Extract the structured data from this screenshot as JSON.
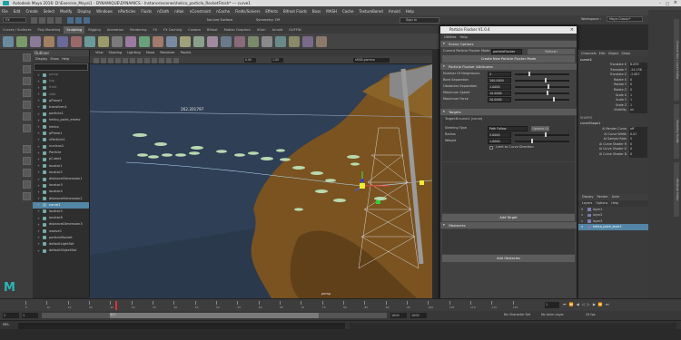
{
  "window": {
    "title": "Autodesk Maya 2016: D:\\Exercise_Maya\\1 - DYNAMIQUE\\DYNAMICS - Instance\\scenes\\helico_particle_RocketFinish*    ---   curve1",
    "workspace_label": "Workspace :",
    "workspace_value": "Maya Classic*"
  },
  "menubar": [
    "File",
    "Edit",
    "Create",
    "Select",
    "Modify",
    "Display",
    "Windows",
    "nParticles",
    "Fluids",
    "nCloth",
    "nHair",
    "nConstraint",
    "nCache",
    "Fields/Solvers",
    "Effects",
    "Bifrost Fluids",
    "Boss",
    "MASH",
    "Cache",
    "TextureBored",
    "Arnold",
    "Help"
  ],
  "statusline": {
    "mode": "FX",
    "live_surface": "No Live Surface",
    "symmetry": "Symmetry: Off",
    "sign_in": "Sign In"
  },
  "shelf_tabs": [
    "Curves / Surfaces",
    "Poly Modeling",
    "Sculpting",
    "Rigging",
    "Animation",
    "Rendering",
    "FX",
    "FX Caching",
    "Custom",
    "Bifrost",
    "Motion Graphics",
    "XGen",
    "Arnold",
    "GUFFIN"
  ],
  "shelf_active": "Sculpting",
  "outliner": {
    "title": "Outliner",
    "menu": [
      "Display",
      "Show",
      "Help"
    ],
    "items": [
      {
        "label": "persp",
        "dim": true
      },
      {
        "label": "top",
        "dim": true
      },
      {
        "label": "front",
        "dim": true
      },
      {
        "label": "side",
        "dim": true
      },
      {
        "label": "pPlane1"
      },
      {
        "label": "transform1"
      },
      {
        "label": "particle1"
      },
      {
        "label": "helico_point_emetc"
      },
      {
        "label": "helico"
      },
      {
        "label": "pPlane1"
      },
      {
        "label": "nParticle1"
      },
      {
        "label": "nucleus1"
      },
      {
        "label": "Particle"
      },
      {
        "label": "pCube1"
      },
      {
        "label": "locator1"
      },
      {
        "label": "locator2"
      },
      {
        "label": "distanceDimension1"
      },
      {
        "label": "locator3"
      },
      {
        "label": "locator4"
      },
      {
        "label": "distanceDimension2"
      },
      {
        "label": "curve1",
        "selected": true
      },
      {
        "label": "locator5"
      },
      {
        "label": "locator6"
      },
      {
        "label": "distanceDimension3"
      },
      {
        "label": "uwave1"
      },
      {
        "label": "particleRocket"
      },
      {
        "label": "defaultLightSet"
      },
      {
        "label": "defaultObjectSet"
      }
    ]
  },
  "viewport": {
    "menu": [
      "View",
      "Shading",
      "Lighting",
      "Show",
      "Renderer",
      "Panels"
    ],
    "colorspace": "sRGB gamma",
    "exposure": "0.00",
    "gamma": "1.00",
    "distance_readout": "262.201797",
    "camera_label": "persp",
    "colors": {
      "sky": "#2f3f55",
      "cliff": "#7a5320",
      "cliff_dark": "#5a3c18",
      "ground": "#4f3a1c",
      "tower": "#d8d8d8",
      "helico": "#b8d9b0"
    }
  },
  "particle_flocker": {
    "title": "Particle Flocker V1.0.4",
    "menu": [
      "Utilities",
      "Help"
    ],
    "scene_options": "Scene Options",
    "current_mode_label": "Current Particle Flocker Mode",
    "current_mode_value": "particleFlocker",
    "refresh": "Refresh",
    "create_button": "Create New Particle Flocker Mode",
    "attributes_frame": "Particle Flocker Attributes",
    "attributes": [
      {
        "label": "Number Of Neighbours",
        "value": "2",
        "fill": 0.25
      },
      {
        "label": "Bord Separation",
        "value": "100.0000",
        "fill": 0.55
      },
      {
        "label": "Obstacles Separation",
        "value": "1.0000",
        "fill": 0.6
      },
      {
        "label": "Maximum Speed",
        "value": "10.0000",
        "fill": 0.58
      },
      {
        "label": "Maximum Force",
        "value": "20.0000",
        "fill": 0.7
      }
    ],
    "targets_frame": "Targets",
    "target_name": "Target:B:curve1 (curve)",
    "steering_label": "Steering Type",
    "steering_value": "Path Follow",
    "update_button": "Update UI",
    "radius_label": "Radius",
    "radius_value": "3.0000",
    "weight_label": "Weight",
    "weight_value": "1.0000",
    "limit_label": "Limit to Curve Direction",
    "add_target": "Add Target",
    "obstacles_frame": "Obstacles",
    "add_obstacles": "Add Obstacles"
  },
  "channel_box": {
    "menu": [
      "Channels",
      "Edit",
      "Object",
      "Show"
    ],
    "object": "curve1",
    "channels": [
      {
        "label": "Translate X",
        "value": "6.039"
      },
      {
        "label": "Translate Y",
        "value": "-24.136"
      },
      {
        "label": "Translate Z",
        "value": "-2.657"
      },
      {
        "label": "Rotate X",
        "value": "0"
      },
      {
        "label": "Rotate Y",
        "value": "0"
      },
      {
        "label": "Rotate Z",
        "value": "0"
      },
      {
        "label": "Scale X",
        "value": "1"
      },
      {
        "label": "Scale Y",
        "value": "1"
      },
      {
        "label": "Scale Z",
        "value": "1"
      },
      {
        "label": "Visibility",
        "value": "on"
      }
    ],
    "shapes_header": "SHAPES",
    "shape_name": "curveShape1",
    "shape_attrs": [
      {
        "label": "Ai Render Curve",
        "value": "off"
      },
      {
        "label": "Ai Curve Width",
        "value": "0.01"
      },
      {
        "label": "Ai Sample Rate",
        "value": "5"
      },
      {
        "label": "Ai Curve Shader R",
        "value": "0"
      },
      {
        "label": "Ai Curve Shader G",
        "value": "0"
      },
      {
        "label": "Ai Curve Shader B",
        "value": "0"
      }
    ],
    "layer_tabs": [
      "Display",
      "Render",
      "Anim"
    ],
    "layer_menu": [
      "Layers",
      "Options",
      "Help"
    ],
    "layers": [
      {
        "label": "layer1",
        "selected": false
      },
      {
        "label": "layer2",
        "selected": false
      },
      {
        "label": "layer3",
        "selected": false
      },
      {
        "label": "helico_point_layer1",
        "selected": true
      }
    ]
  },
  "right_tabs": [
    "Channel Box / Layer Editor",
    "Modeling Toolkit",
    "Attribute Editor"
  ],
  "time": {
    "ticks": [
      "5",
      "10",
      "15",
      "20",
      "25",
      "30",
      "35",
      "40",
      "45",
      "50",
      "55",
      "60",
      "65",
      "70",
      "75",
      "80",
      "85",
      "90",
      "95",
      "100",
      "105",
      "110",
      "115",
      "120"
    ],
    "current": "1",
    "start": "1",
    "start2": "1",
    "range_start": "800",
    "end": "1000",
    "range_end": "1000",
    "character_set": "No Character Set",
    "anim_layer": "No Anim Layer",
    "fps": "24 fps"
  },
  "mel": {
    "label": "MEL"
  }
}
